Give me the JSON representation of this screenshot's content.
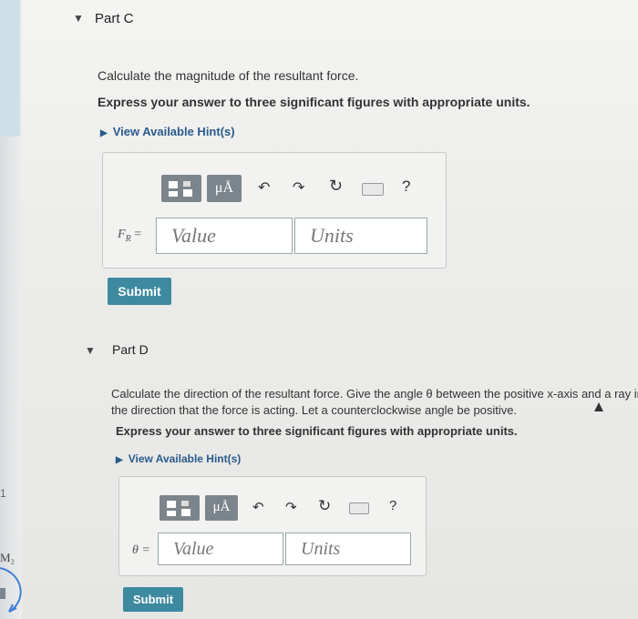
{
  "left_margin": {
    "number": "1",
    "m2_label": "M₂"
  },
  "part_c": {
    "title": "Part C",
    "question": "Calculate the magnitude of the resultant force.",
    "instruction": "Express your answer to three significant figures with appropriate units.",
    "hint_label": "View Available Hint(s)",
    "toolbar": {
      "units_symbol": "μÅ",
      "help": "?"
    },
    "input_label": "F",
    "input_label_sub": "R",
    "input_label_eq": " =",
    "value_placeholder": "Value",
    "units_placeholder": "Units",
    "submit_label": "Submit"
  },
  "part_d": {
    "title": "Part D",
    "question_line1": "Calculate the direction of the resultant force. Give the angle θ between the positive x-axis and a ray in",
    "question_line2": "the direction that the force is acting. Let a counterclockwise angle be positive.",
    "instruction": "Express your answer to three significant figures with appropriate units.",
    "hint_label": "View Available Hint(s)",
    "toolbar": {
      "units_symbol": "μÅ",
      "help": "?"
    },
    "input_label": "θ =",
    "value_placeholder": "Value",
    "units_placeholder": "Units",
    "submit_label": "Submit"
  }
}
